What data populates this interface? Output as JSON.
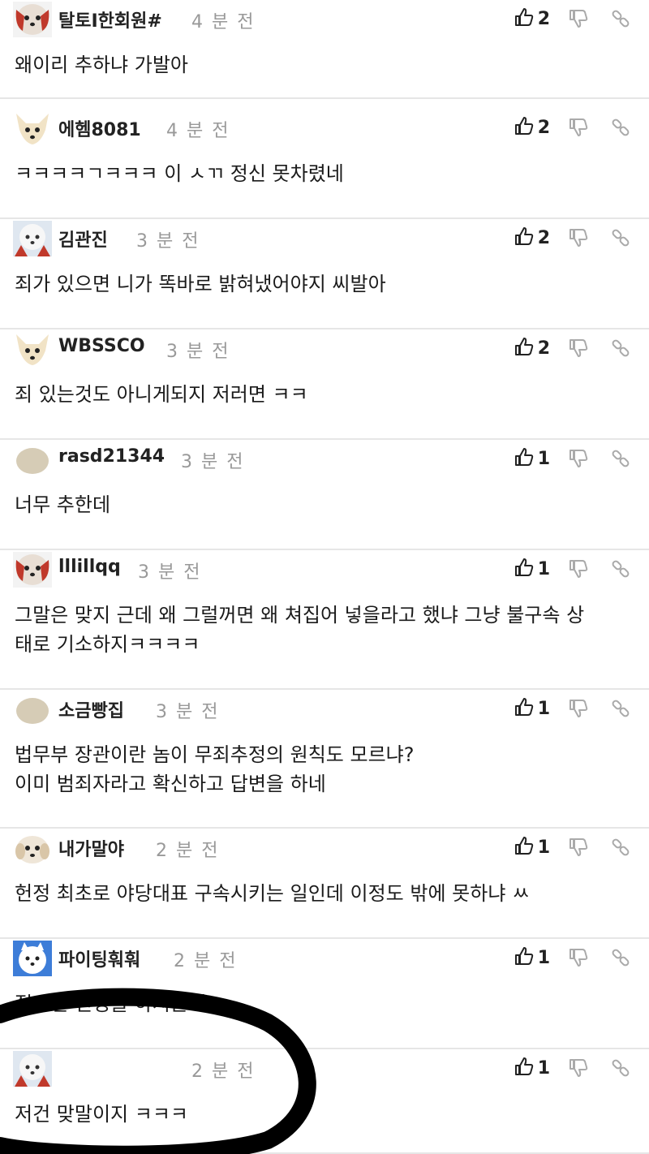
{
  "comments": [
    {
      "nick": "탈토I한회원#",
      "time": "4 분 전",
      "likes": "2",
      "text": "왜이리 추하냐 가발아",
      "avatar_icon": "dog-avatar-icon"
    },
    {
      "nick": "에헴8081",
      "time": "4 분 전",
      "likes": "2",
      "text": "ㅋㅋㅋㅋㄱㅋㅋㅋ 이 ㅅㄲ 정신 못차렸네",
      "avatar_icon": "chihuahua-avatar-icon"
    },
    {
      "nick": "김관진",
      "time": "3 분 전",
      "likes": "2",
      "text": "죄가 있으면 니가 똑바로 밝혀냈어야지 씨발아",
      "avatar_icon": "white-dog-avatar-icon"
    },
    {
      "nick": "WBSSCO",
      "time": "3 분 전",
      "likes": "2",
      "text": "죄 있는것도 아니게되지 저러면 ㅋㅋ",
      "avatar_icon": "chihuahua-avatar-icon"
    },
    {
      "nick": "rasd21344",
      "time": "3 분 전",
      "likes": "1",
      "text": "너무 추한데",
      "avatar_icon": "egg-avatar-icon"
    },
    {
      "nick": "lllillqq",
      "time": "3 분 전",
      "likes": "1",
      "text": "그말은 맞지 근데 왜 그럴꺼면 왜 쳐집어 넣을라고 했냐 그냥 불구속 상\n태로 기소하지ㅋㅋㅋㅋ",
      "avatar_icon": "dog-avatar-icon"
    },
    {
      "nick": "소금빵집",
      "time": "3 분 전",
      "likes": "1",
      "text": "법무부 장관이란 놈이 무죄추정의 원칙도 모르냐?\n이미 범죄자라고 확신하고 답변을 하네",
      "avatar_icon": "egg-avatar-icon"
    },
    {
      "nick": "내가말야",
      "time": "2 분 전",
      "likes": "1",
      "text": "헌정 최초로 야당대표 구속시키는 일인데 이정도 밖에 못하냐 ㅆ",
      "avatar_icon": "puppy-avatar-icon"
    },
    {
      "nick": "파이팅훠훠",
      "time": "2 분 전",
      "likes": "1",
      "text": "젊으면 인정을 하시는게",
      "avatar_icon": "spitz-avatar-icon"
    },
    {
      "nick": "",
      "time": "2 분 전",
      "likes": "1",
      "text": "저건 맞말이지 ㅋㅋㅋ",
      "avatar_icon": "white-dog-avatar-icon"
    }
  ],
  "colors": {
    "text": "#1a1a1a",
    "muted": "#999999",
    "divider": "#e6e6e6",
    "annotation": "#000000"
  }
}
